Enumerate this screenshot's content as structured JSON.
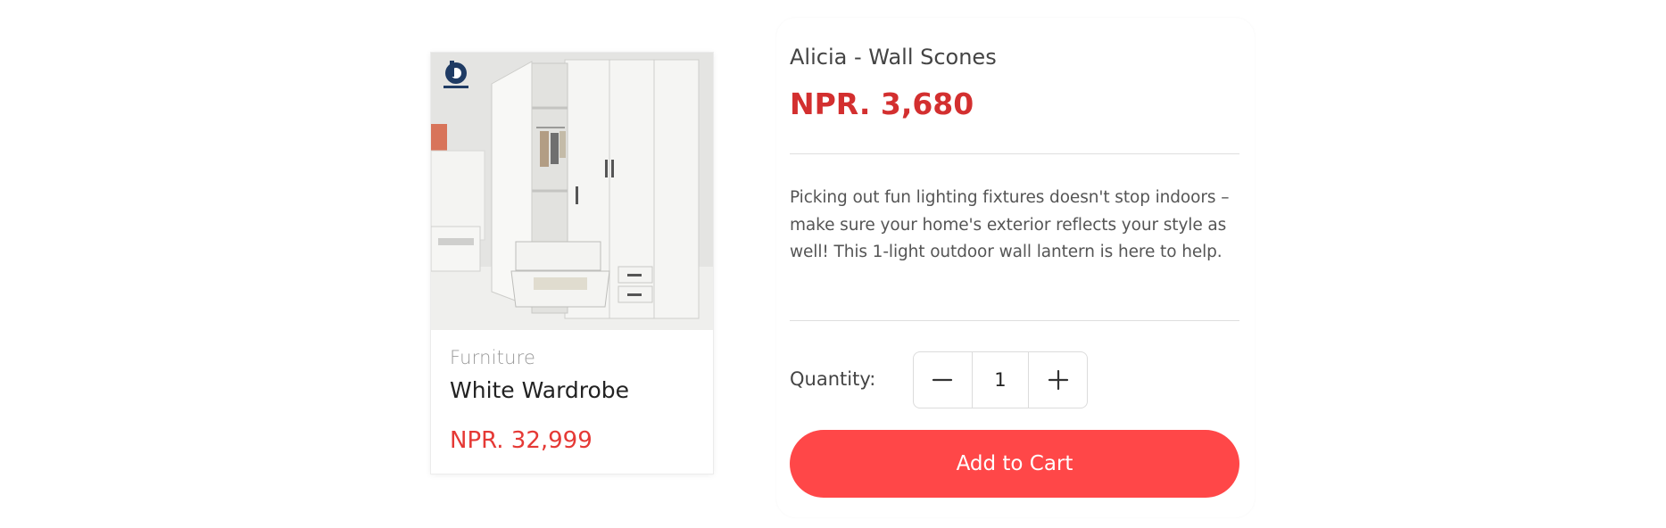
{
  "product_card": {
    "image_alt": "White wardrobe with open door and drawers",
    "category": "Furniture",
    "title": "White Wardrobe",
    "price": "NPR. 32,999"
  },
  "product_detail": {
    "title": "Alicia - Wall Scones",
    "price": "NPR. 3,680",
    "description": "Picking out fun lighting fixtures doesn't stop indoors – make sure your home's exterior reflects your style as well! This 1-light outdoor wall lantern is here to help.",
    "quantity_label": "Quantity:",
    "quantity_value": "1",
    "add_to_cart_label": "Add to Cart"
  },
  "icons": {
    "decrease": "minus-icon",
    "increase": "plus-icon",
    "brand_logo": "brand-logo-icon"
  },
  "colors": {
    "price_red": "#d32f2f",
    "card_price_red": "#e53935",
    "button_red": "#ff4748"
  }
}
